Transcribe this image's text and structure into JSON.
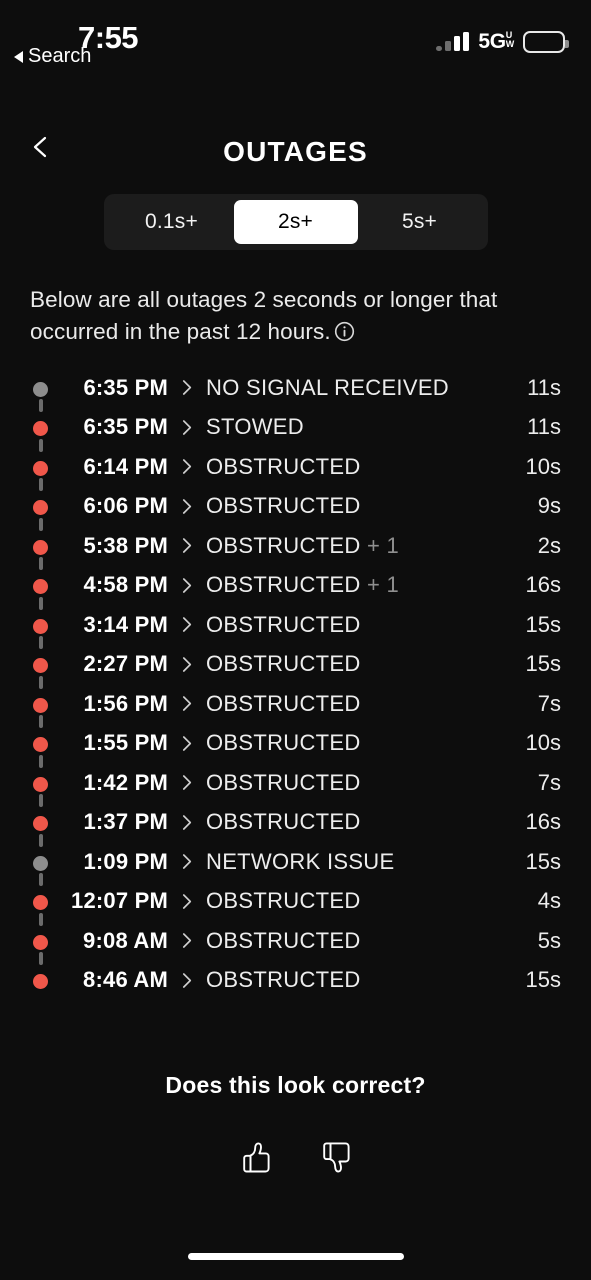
{
  "status_bar": {
    "time": "7:55",
    "back_label": "Search",
    "network": "5G",
    "network_sub_top": "U",
    "network_sub_bottom": "W"
  },
  "header": {
    "title": "OUTAGES"
  },
  "filter": {
    "options": [
      "0.1s+",
      "2s+",
      "5s+"
    ],
    "selected": "2s+"
  },
  "description": {
    "text": "Below are all outages 2 seconds or longer that occurred in the past 12 hours."
  },
  "outages": [
    {
      "time": "6:35 PM",
      "label": "NO SIGNAL RECEIVED",
      "extra": "",
      "duration": "11s",
      "severity": "gray"
    },
    {
      "time": "6:35 PM",
      "label": "STOWED",
      "extra": "",
      "duration": "11s",
      "severity": "red"
    },
    {
      "time": "6:14 PM",
      "label": "OBSTRUCTED",
      "extra": "",
      "duration": "10s",
      "severity": "red"
    },
    {
      "time": "6:06 PM",
      "label": "OBSTRUCTED",
      "extra": "",
      "duration": "9s",
      "severity": "red"
    },
    {
      "time": "5:38 PM",
      "label": "OBSTRUCTED",
      "extra": "+ 1",
      "duration": "2s",
      "severity": "red"
    },
    {
      "time": "4:58 PM",
      "label": "OBSTRUCTED",
      "extra": "+ 1",
      "duration": "16s",
      "severity": "red"
    },
    {
      "time": "3:14 PM",
      "label": "OBSTRUCTED",
      "extra": "",
      "duration": "15s",
      "severity": "red"
    },
    {
      "time": "2:27 PM",
      "label": "OBSTRUCTED",
      "extra": "",
      "duration": "15s",
      "severity": "red"
    },
    {
      "time": "1:56 PM",
      "label": "OBSTRUCTED",
      "extra": "",
      "duration": "7s",
      "severity": "red"
    },
    {
      "time": "1:55 PM",
      "label": "OBSTRUCTED",
      "extra": "",
      "duration": "10s",
      "severity": "red"
    },
    {
      "time": "1:42 PM",
      "label": "OBSTRUCTED",
      "extra": "",
      "duration": "7s",
      "severity": "red"
    },
    {
      "time": "1:37 PM",
      "label": "OBSTRUCTED",
      "extra": "",
      "duration": "16s",
      "severity": "red"
    },
    {
      "time": "1:09 PM",
      "label": "NETWORK ISSUE",
      "extra": "",
      "duration": "15s",
      "severity": "gray"
    },
    {
      "time": "12:07 PM",
      "label": "OBSTRUCTED",
      "extra": "",
      "duration": "4s",
      "severity": "red"
    },
    {
      "time": "9:08 AM",
      "label": "OBSTRUCTED",
      "extra": "",
      "duration": "5s",
      "severity": "red"
    },
    {
      "time": "8:46 AM",
      "label": "OBSTRUCTED",
      "extra": "",
      "duration": "15s",
      "severity": "red"
    }
  ],
  "feedback": {
    "question": "Does this look correct?"
  },
  "colors": {
    "background": "#0d0d0d",
    "severity_red": "#f0574a",
    "severity_gray": "#8d8d8d",
    "segment_track": "#1c1c1c",
    "accent_white": "#ffffff"
  }
}
